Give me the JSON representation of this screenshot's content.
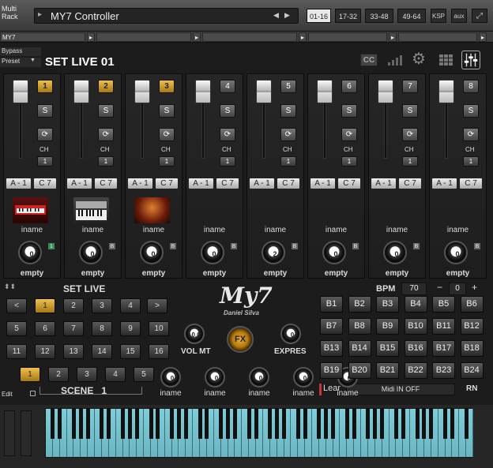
{
  "header": {
    "rack_label": "Multi Rack",
    "instrument_title": "MY7 Controller",
    "ranges": [
      "01-16",
      "17-32",
      "33-48",
      "49-64"
    ],
    "active_range": "01-16",
    "ksp_label": "KSP",
    "aux_label": "aux"
  },
  "tabs": {
    "instrument_tab": "MY7"
  },
  "panel": {
    "bypass_label": "Bypass",
    "preset_label": "Preset",
    "set_title": "SET LIVE 01",
    "cc_label": "CC"
  },
  "strips": [
    {
      "num": "1",
      "gold": true,
      "s": "S",
      "ch": "CH",
      "ch_val": "1",
      "a": "A - 1",
      "c": "C 7",
      "name": "iname",
      "knob": "0",
      "badge": "1",
      "badge_green": true,
      "state": "empty",
      "instrument": "keyboard-red"
    },
    {
      "num": "2",
      "gold": true,
      "s": "S",
      "ch": "CH",
      "ch_val": "1",
      "a": "A - 1",
      "c": "C 7",
      "name": "iname",
      "knob": "0",
      "badge": "B",
      "badge_green": false,
      "state": "empty",
      "instrument": "synth-keys"
    },
    {
      "num": "3",
      "gold": true,
      "s": "S",
      "ch": "CH",
      "ch_val": "1",
      "a": "A - 1",
      "c": "C 7",
      "name": "iname",
      "knob": "0",
      "badge": "B",
      "badge_green": false,
      "state": "empty",
      "instrument": "orchestral"
    },
    {
      "num": "4",
      "gold": false,
      "s": "S",
      "ch": "CH",
      "ch_val": "1",
      "a": "A - 1",
      "c": "C 7",
      "name": "iname",
      "knob": "0",
      "badge": "B",
      "badge_green": false,
      "state": "empty",
      "instrument": ""
    },
    {
      "num": "5",
      "gold": false,
      "s": "S",
      "ch": "CH",
      "ch_val": "1",
      "a": "A - 1",
      "c": "C 7",
      "name": "iname",
      "knob": "2",
      "badge": "B",
      "badge_green": false,
      "state": "empty",
      "instrument": ""
    },
    {
      "num": "6",
      "gold": false,
      "s": "S",
      "ch": "CH",
      "ch_val": "1",
      "a": "A - 1",
      "c": "C 7",
      "name": "iname",
      "knob": "0",
      "badge": "B",
      "badge_green": false,
      "state": "empty",
      "instrument": ""
    },
    {
      "num": "7",
      "gold": false,
      "s": "S",
      "ch": "CH",
      "ch_val": "1",
      "a": "A - 1",
      "c": "C 7",
      "name": "iname",
      "knob": "0",
      "badge": "B",
      "badge_green": false,
      "state": "empty",
      "instrument": ""
    },
    {
      "num": "8",
      "gold": false,
      "s": "S",
      "ch": "CH",
      "ch_val": "1",
      "a": "A - 1",
      "c": "C 7",
      "name": "iname",
      "knob": "0",
      "badge": "B",
      "badge_green": false,
      "state": "empty",
      "instrument": ""
    }
  ],
  "setlive": {
    "label": "SET LIVE",
    "nav_prev": "<",
    "nav_next": ">",
    "buttons": [
      "1",
      "2",
      "3",
      "4",
      "5",
      "6",
      "7",
      "8",
      "9",
      "10",
      "11",
      "12",
      "13",
      "14",
      "15",
      "16"
    ],
    "active": "1"
  },
  "scene": {
    "buttons": [
      "1",
      "2",
      "3",
      "4",
      "5"
    ],
    "active": "1",
    "label": "SCENE",
    "value": "1",
    "edit_label": "Edit"
  },
  "center": {
    "logo": "My7",
    "author": "Daniel Silva",
    "vol_label": "VOL MT",
    "vol_value": "0.0",
    "fx_label": "FX",
    "expres_label": "EXPRES",
    "expres_value": "0",
    "bottom_knobs": [
      {
        "value": "0",
        "label": "iname"
      },
      {
        "value": "0",
        "label": "iname"
      },
      {
        "value": "0",
        "label": "iname"
      },
      {
        "value": "0",
        "label": "iname"
      },
      {
        "value": "0",
        "label": "iname"
      }
    ]
  },
  "bpm": {
    "label": "BPM",
    "value": "70",
    "minus": "−",
    "transpose": "0",
    "plus": "+"
  },
  "b_buttons": [
    "B1",
    "B2",
    "B3",
    "B4",
    "B5",
    "B6",
    "B7",
    "B8",
    "B9",
    "B10",
    "B11",
    "B12",
    "B13",
    "B14",
    "B15",
    "B16",
    "B17",
    "B18",
    "B19",
    "B20",
    "B21",
    "B22",
    "B23",
    "B24"
  ],
  "midi": {
    "learn": "Lear",
    "status": "Midi IN OFF",
    "rn": "RN"
  },
  "colors": {
    "gold": "#d9a528",
    "keyboard": "#7ec8d4",
    "background": "#1c1c1c"
  }
}
